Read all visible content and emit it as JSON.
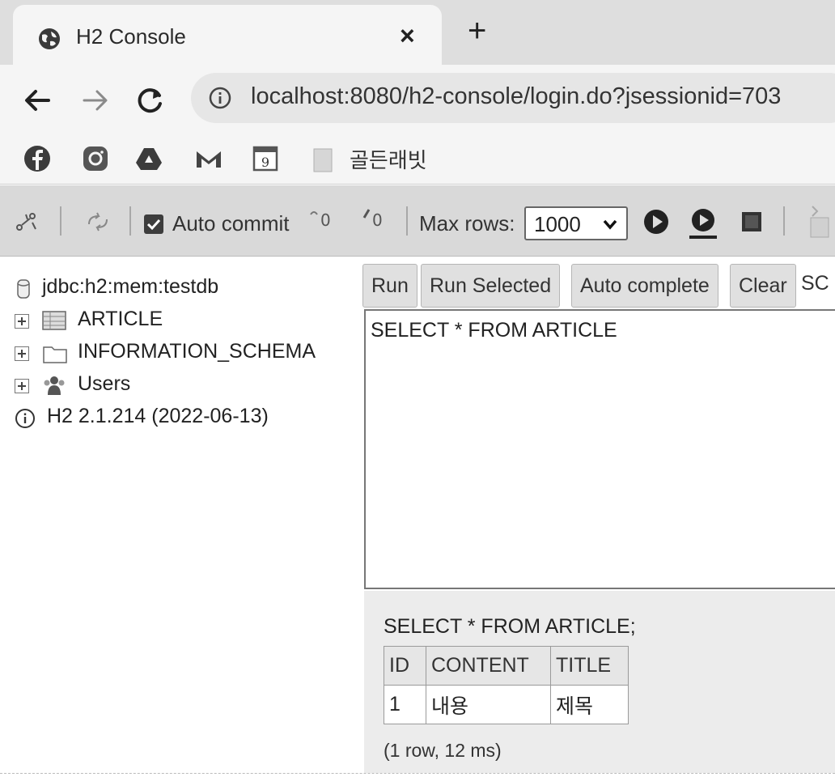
{
  "browser": {
    "tab_title": "H2 Console",
    "tab_close": "×",
    "new_tab": "+",
    "url": "localhost:8080/h2-console/login.do?jsessionid=703",
    "bookmarks": {
      "calendar_day": "9",
      "folder_label": "골든래빗"
    }
  },
  "h2_toolbar": {
    "auto_commit_label": "Auto commit",
    "auto_commit_checked": true,
    "max_rows_label": "Max rows:",
    "max_rows_value": "1000"
  },
  "tree": {
    "connection": "jdbc:h2:mem:testdb",
    "items": [
      {
        "label": "ARTICLE",
        "icon": "table-icon"
      },
      {
        "label": "INFORMATION_SCHEMA",
        "icon": "folder-icon"
      },
      {
        "label": "Users",
        "icon": "users-icon"
      }
    ],
    "version": "H2 2.1.214 (2022-06-13)"
  },
  "query": {
    "buttons": [
      "Run",
      "Run Selected",
      "Auto complete",
      "Clear"
    ],
    "sql_label_truncated": "SC",
    "editor_text": "SELECT * FROM ARTICLE"
  },
  "results": {
    "statement": "SELECT * FROM ARTICLE;",
    "columns": [
      "ID",
      "CONTENT",
      "TITLE"
    ],
    "rows": [
      [
        "1",
        "내용",
        "제목"
      ]
    ],
    "summary": "(1 row, 12 ms)"
  },
  "colors": {
    "tabstrip": "#dedede",
    "toolbar": "#f5f5f5",
    "h2_toolbar": "#d9d9d9",
    "results_bg": "#ececec"
  }
}
